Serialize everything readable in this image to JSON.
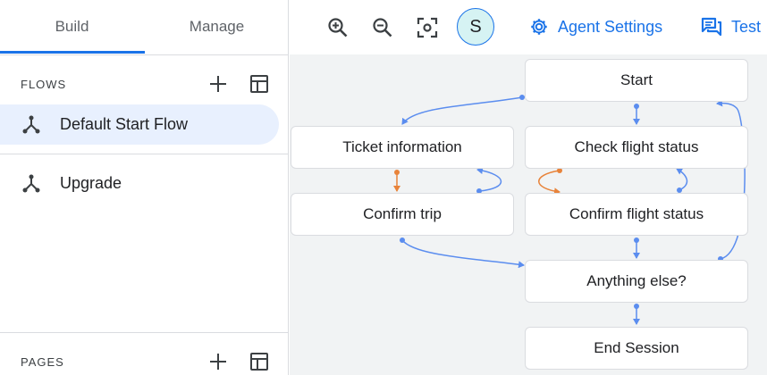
{
  "colors": {
    "accent": "#1a73e8",
    "edge_blue": "#5b8def",
    "edge_orange": "#e8833a",
    "selected_bg": "#e8f0fe"
  },
  "sidebar": {
    "tabs": [
      {
        "label": "Build",
        "active": true
      },
      {
        "label": "Manage",
        "active": false
      }
    ],
    "flows_title": "FLOWS",
    "flows": [
      {
        "label": "Default Start Flow",
        "selected": true,
        "icon": "flow-icon"
      },
      {
        "label": "Upgrade",
        "selected": false,
        "icon": "flow-icon"
      }
    ],
    "pages_title": "PAGES"
  },
  "toolbar": {
    "zoom_in_icon": "zoom-in-icon",
    "zoom_out_icon": "zoom-out-icon",
    "fit_icon": "center-focus-icon",
    "avatar_letter": "S",
    "agent_settings_label": "Agent Settings",
    "test_label": "Test"
  },
  "canvas": {
    "nodes": {
      "start": "Start",
      "ticket_information": "Ticket information",
      "check_flight_status": "Check flight status",
      "confirm_trip": "Confirm trip",
      "confirm_flight_status": "Confirm flight status",
      "anything_else": "Anything else?",
      "end_session": "End Session"
    }
  }
}
